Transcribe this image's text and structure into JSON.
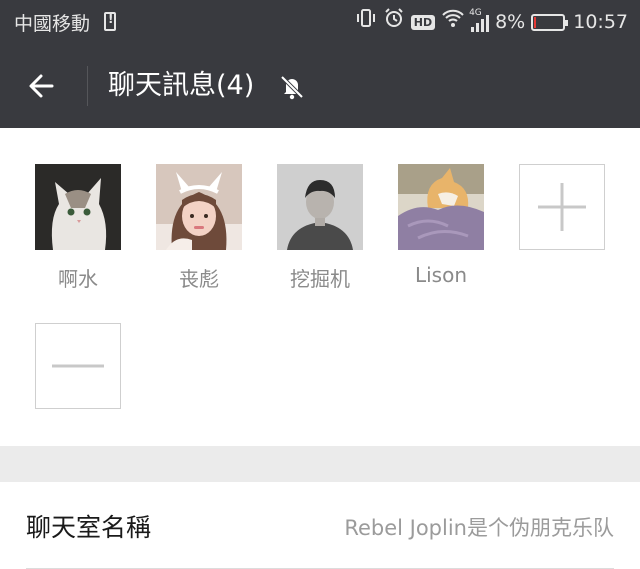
{
  "status_bar": {
    "carrier": "中國移動",
    "net_type": "4G",
    "hd_label": "HD",
    "battery_percent": "8%",
    "battery_level": 0.08,
    "time": "10:57",
    "icons": [
      "sim-alert-icon",
      "vibrate-icon",
      "alarm-icon",
      "hd-icon",
      "wifi-icon",
      "signal-icon",
      "battery-icon"
    ]
  },
  "nav": {
    "title": "聊天訊息(4)",
    "back_icon": "arrow-left-icon",
    "mute_icon": "bell-off-icon"
  },
  "members": [
    {
      "name": "啊水",
      "avatar": "cat-photo"
    },
    {
      "name": "丧彪",
      "avatar": "girl-photo"
    },
    {
      "name": "挖掘机",
      "avatar": "man-photo"
    },
    {
      "name": "Lison",
      "avatar": "cat-blanket-photo"
    }
  ],
  "actions": {
    "add_icon": "plus-icon",
    "remove_icon": "minus-icon"
  },
  "settings": {
    "chat_name_label": "聊天室名稱",
    "chat_name_value": "Rebel Joplin是个伪朋克乐队"
  },
  "colors": {
    "bar": "#393a3f",
    "background": "#ebebeb",
    "muted_text": "#8a8a8a"
  }
}
